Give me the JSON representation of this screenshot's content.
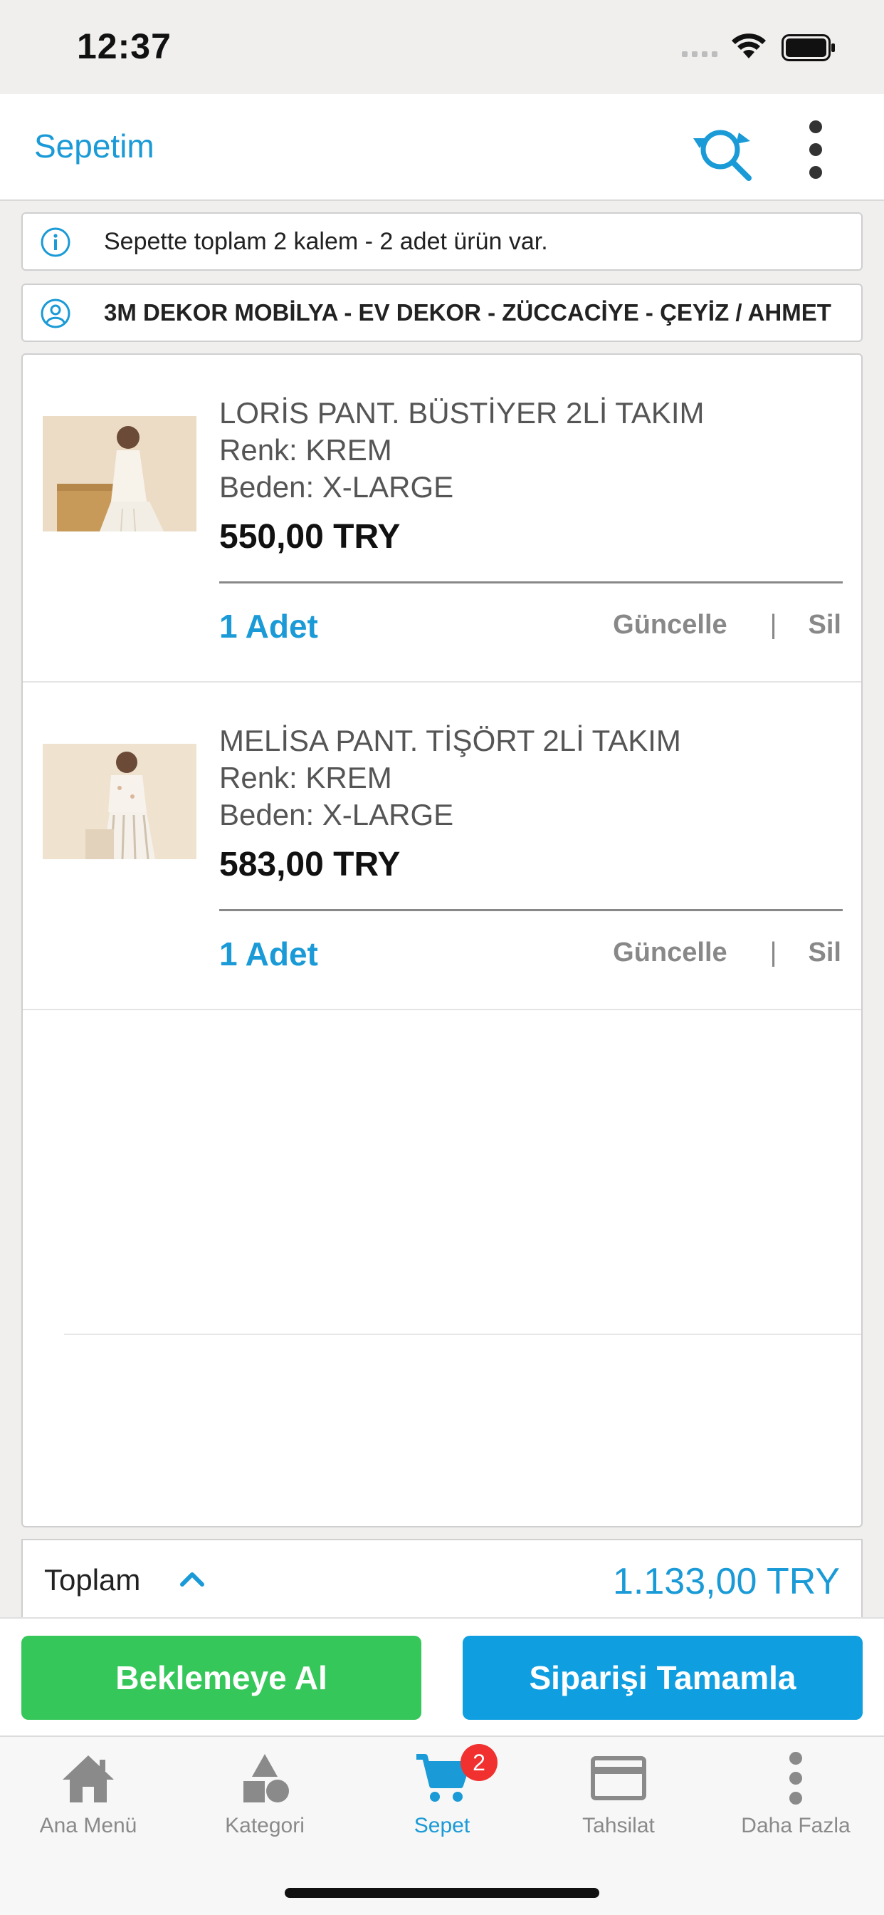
{
  "status_bar": {
    "time": "12:37"
  },
  "nav": {
    "title": "Sepetim"
  },
  "info": {
    "summary": "Sepette toplam 2 kalem - 2 adet ürün var.",
    "customer": "3M DEKOR MOBİLYA - EV DEKOR - ZÜCCACİYE - ÇEYİZ / AHMET"
  },
  "cart_items": [
    {
      "name": "LORİS PANT. BÜSTİYER 2Lİ TAKIM",
      "color": "Renk: KREM",
      "size": "Beden: X-LARGE",
      "price": "550,00 TRY",
      "qty": "1 Adet",
      "update_label": "Güncelle",
      "separator": "|",
      "delete_label": "Sil"
    },
    {
      "name": "MELİSA PANT. TİŞÖRT 2Lİ TAKIM",
      "color": "Renk: KREM",
      "size": "Beden: X-LARGE",
      "price": "583,00 TRY",
      "qty": "1 Adet",
      "update_label": "Güncelle",
      "separator": "|",
      "delete_label": "Sil"
    }
  ],
  "total": {
    "label": "Toplam",
    "value": "1.133,00 TRY"
  },
  "buttons": {
    "hold": "Beklemeye Al",
    "complete": "Siparişi Tamamla"
  },
  "tabs": [
    {
      "label": "Ana Menü",
      "icon": "home-icon"
    },
    {
      "label": "Kategori",
      "icon": "shapes-icon"
    },
    {
      "label": "Sepet",
      "icon": "cart-icon",
      "badge": "2",
      "active": true
    },
    {
      "label": "Tahsilat",
      "icon": "credit-card-icon"
    },
    {
      "label": "Daha Fazla",
      "icon": "more-vertical-icon"
    }
  ],
  "colors": {
    "accent": "#1a9ad6",
    "green": "#35c759",
    "blue_button": "#0f9ee0",
    "badge": "#f0312f"
  }
}
